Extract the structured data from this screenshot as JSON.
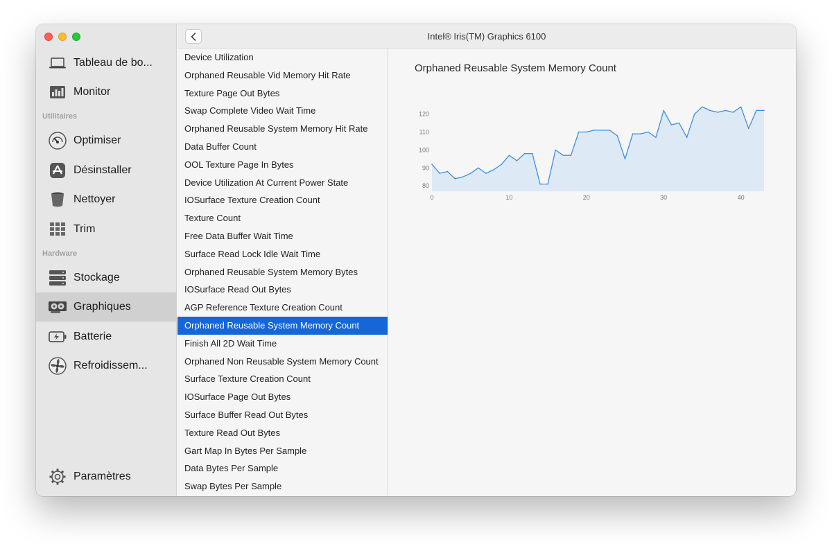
{
  "window": {
    "title": "Intel® Iris(TM) Graphics 6100"
  },
  "sidebar": {
    "items_top": [
      {
        "label": "Tableau de bo...",
        "icon": "laptop-icon"
      },
      {
        "label": "Monitor",
        "icon": "monitor-icon"
      }
    ],
    "section_utilities": "Utilitaires",
    "items_utilities": [
      {
        "label": "Optimiser",
        "icon": "gauge-icon"
      },
      {
        "label": "Désinstaller",
        "icon": "app-store-icon"
      },
      {
        "label": "Nettoyer",
        "icon": "trash-icon"
      },
      {
        "label": "Trim",
        "icon": "grid-icon"
      }
    ],
    "section_hardware": "Hardware",
    "items_hardware": [
      {
        "label": "Stockage",
        "icon": "storage-icon"
      },
      {
        "label": "Graphiques",
        "icon": "gpu-icon",
        "active": true
      },
      {
        "label": "Batterie",
        "icon": "battery-icon"
      },
      {
        "label": "Refroidissem...",
        "icon": "fan-icon"
      }
    ],
    "settings": {
      "label": "Paramètres",
      "icon": "gear-icon"
    }
  },
  "metrics": [
    "Device Utilization",
    "Orphaned Reusable Vid Memory Hit Rate",
    "Texture Page Out Bytes",
    "Swap Complete Video Wait Time",
    "Orphaned Reusable System Memory Hit Rate",
    "Data Buffer Count",
    "OOL Texture Page In Bytes",
    "Device Utilization At Current Power State",
    "IOSurface Texture Creation Count",
    "Texture Count",
    "Free Data Buffer Wait Time",
    "Surface Read Lock Idle Wait Time",
    "Orphaned Reusable System Memory Bytes",
    "IOSurface Read Out Bytes",
    "AGP Reference Texture Creation Count",
    "Orphaned Reusable System Memory Count",
    "Finish All 2D Wait Time",
    "Orphaned Non Reusable System Memory Count",
    "Surface Texture Creation Count",
    "IOSurface Page Out Bytes",
    "Surface Buffer Read Out Bytes",
    "Texture Read Out Bytes",
    "Gart Map In Bytes Per Sample",
    "Data Bytes Per Sample",
    "Swap Bytes Per Sample"
  ],
  "selected_metric": "Orphaned Reusable System Memory Count",
  "colors": {
    "accent": "#1566d9",
    "line": "#3d8fe0",
    "fill": "#d6e4f5"
  },
  "chart_data": {
    "type": "area",
    "title": "Orphaned Reusable System Memory Count",
    "xlabel": "",
    "ylabel": "",
    "xlim": [
      0,
      43
    ],
    "ylim": [
      77,
      126
    ],
    "xticks": [
      0,
      10,
      20,
      30,
      40
    ],
    "yticks": [
      80,
      90,
      100,
      110,
      120
    ],
    "grid": false,
    "x": [
      0,
      1,
      2,
      3,
      4,
      5,
      6,
      7,
      8,
      9,
      10,
      11,
      12,
      13,
      14,
      15,
      16,
      17,
      18,
      19,
      20,
      21,
      22,
      23,
      24,
      25,
      26,
      27,
      28,
      29,
      30,
      31,
      32,
      33,
      34,
      35,
      36,
      37,
      38,
      39,
      40,
      41,
      42,
      43
    ],
    "values": [
      92,
      87,
      88,
      84,
      85,
      87,
      90,
      87,
      89,
      92,
      97,
      94,
      98,
      98,
      81,
      81,
      100,
      97,
      97,
      110,
      110,
      111,
      111,
      111,
      108,
      95,
      109,
      109,
      110,
      107,
      122,
      114,
      115,
      107,
      120,
      124,
      122,
      121,
      122,
      121,
      124,
      112,
      122,
      122
    ]
  }
}
